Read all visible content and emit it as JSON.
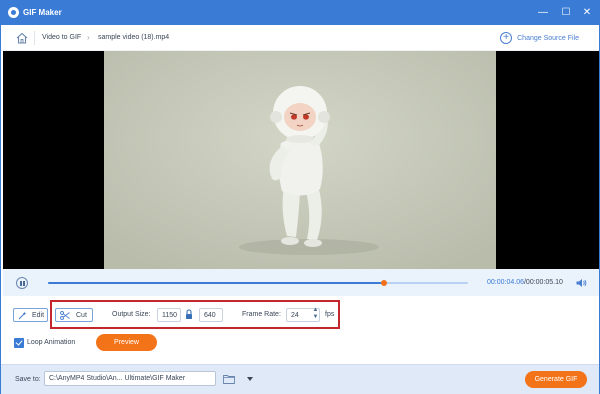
{
  "window": {
    "title": "GIF Maker",
    "controls": [
      "minimize",
      "maximize",
      "close"
    ]
  },
  "breadcrumb": {
    "items": [
      "Video to GIF",
      "sample video (18).mp4"
    ]
  },
  "change_source": {
    "label": "Change Source File"
  },
  "player": {
    "current_time": "00:00:04.06",
    "duration": "/00:00:05.10",
    "progress_fraction": 0.8
  },
  "toolbar": {
    "edit_label": "Edit",
    "cut_label": "Cut",
    "output_size_label": "Output Size:",
    "width": "1150",
    "height": "640",
    "frame_rate_label": "Frame Rate:",
    "frame_rate": "24",
    "fps_label": "fps"
  },
  "options": {
    "loop_label": "Loop Animation",
    "loop_checked": true,
    "preview_label": "Preview"
  },
  "footer": {
    "save_to_label": "Save to:",
    "path": "C:\\AnyMP4 Studio\\An... Ultimate\\GIF Maker",
    "generate_label": "Generate GIF"
  },
  "colors": {
    "accent": "#3a7bd5",
    "orange": "#f27318",
    "highlight": "#c4262e"
  }
}
